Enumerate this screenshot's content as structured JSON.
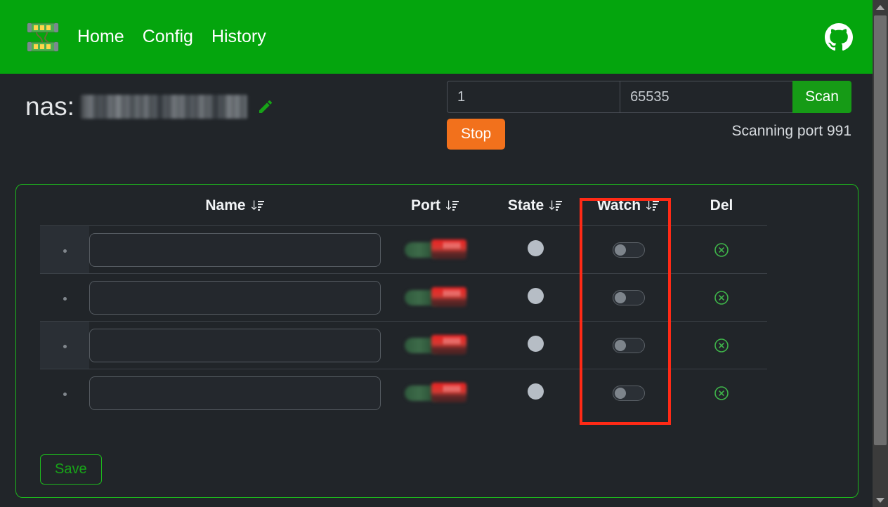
{
  "navbar": {
    "logo_name": "network-switch-logo",
    "links": [
      {
        "label": "Home"
      },
      {
        "label": "Config"
      },
      {
        "label": "History"
      }
    ],
    "github_icon": "github-icon",
    "background_color": "#04a50d"
  },
  "header": {
    "host_label": "nas:",
    "host_value_redacted": true,
    "edit_icon": "pencil-icon"
  },
  "scan": {
    "port_from": "1",
    "port_from_placeholder": "1",
    "port_to": "65535",
    "port_to_placeholder": "65535",
    "scan_label": "Scan",
    "stop_label": "Stop",
    "status": "Scanning port 991",
    "scan_color": "#169b16",
    "stop_color": "#f2711c"
  },
  "table": {
    "columns": [
      {
        "key": "dot",
        "label": "",
        "sortable": false
      },
      {
        "key": "name",
        "label": "Name",
        "sortable": true
      },
      {
        "key": "port",
        "label": "Port",
        "sortable": true
      },
      {
        "key": "state",
        "label": "State",
        "sortable": true
      },
      {
        "key": "watch",
        "label": "Watch",
        "sortable": true
      },
      {
        "key": "del",
        "label": "Del",
        "sortable": false
      }
    ],
    "rows": [
      {
        "dot": "",
        "name": "",
        "name_placeholder": "",
        "port_redacted": true,
        "state": "unknown",
        "watch": false,
        "del_icon": "delete-circle-icon"
      },
      {
        "dot": "",
        "name": "",
        "name_placeholder": "",
        "port_redacted": true,
        "state": "unknown",
        "watch": false,
        "del_icon": "delete-circle-icon"
      },
      {
        "dot": "",
        "name": "",
        "name_placeholder": "",
        "port_redacted": true,
        "state": "unknown",
        "watch": false,
        "del_icon": "delete-circle-icon"
      },
      {
        "dot": "",
        "name": "",
        "name_placeholder": "",
        "port_redacted": true,
        "state": "unknown",
        "watch": false,
        "del_icon": "delete-circle-icon"
      }
    ],
    "save_label": "Save",
    "border_color": "#1db81d"
  },
  "annotation": {
    "target_column": "Watch",
    "color": "#ff2a16"
  },
  "scrollbar": {
    "up_arrow": "scroll-up-arrow-icon",
    "down_arrow": "scroll-down-arrow-icon"
  }
}
